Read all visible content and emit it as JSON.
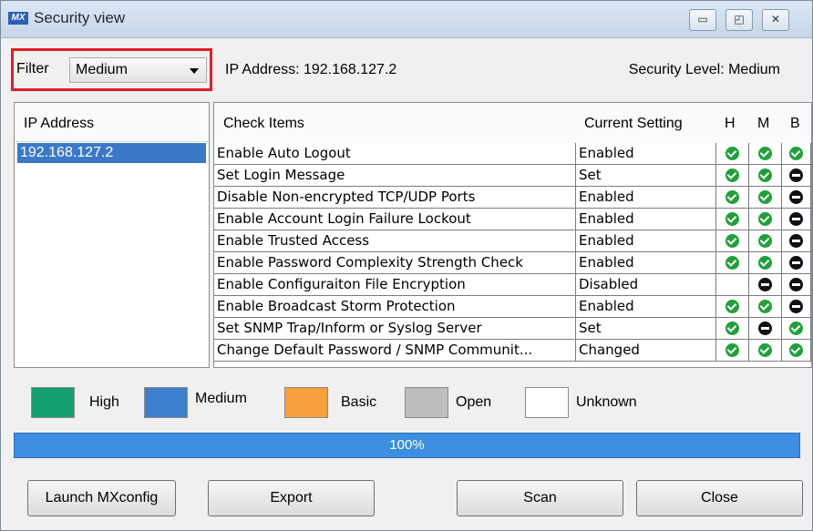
{
  "window": {
    "title": "Security view",
    "app_icon_text": "MX"
  },
  "filter": {
    "label": "Filter",
    "value": "Medium"
  },
  "header": {
    "ip_address_text": "IP Address:  192.168.127.2",
    "security_level_text": "Security Level:  Medium"
  },
  "left_panel": {
    "header": "IP Address",
    "items": [
      "192.168.127.2"
    ]
  },
  "table": {
    "columns": [
      "Check Items",
      "Current Setting",
      "H",
      "M",
      "B"
    ],
    "rows": [
      {
        "item": "Enable Auto Logout",
        "setting": "Enabled",
        "h": "check",
        "m": "check",
        "b": "check"
      },
      {
        "item": "Set Login Message",
        "setting": "Set",
        "h": "check",
        "m": "check",
        "b": "block"
      },
      {
        "item": "Disable Non-encrypted TCP/UDP Ports",
        "setting": "Enabled",
        "h": "check",
        "m": "check",
        "b": "block"
      },
      {
        "item": "Enable Account Login Failure Lockout",
        "setting": "Enabled",
        "h": "check",
        "m": "check",
        "b": "block"
      },
      {
        "item": "Enable Trusted Access",
        "setting": "Enabled",
        "h": "check",
        "m": "check",
        "b": "block"
      },
      {
        "item": "Enable Password Complexity Strength Check",
        "setting": "Enabled",
        "h": "check",
        "m": "check",
        "b": "block"
      },
      {
        "item": "Enable Configuraiton File Encryption",
        "setting": "Disabled",
        "h": "none",
        "m": "block",
        "b": "block"
      },
      {
        "item": "Enable Broadcast Storm Protection",
        "setting": "Enabled",
        "h": "check",
        "m": "check",
        "b": "block"
      },
      {
        "item": "Set SNMP Trap/Inform or Syslog Server",
        "setting": "Set",
        "h": "check",
        "m": "block",
        "b": "check"
      },
      {
        "item": "Change Default Password / SNMP Communit...",
        "setting": "Changed",
        "h": "check",
        "m": "check",
        "b": "check"
      }
    ]
  },
  "legend": [
    {
      "label": "High",
      "color": "#14a06f"
    },
    {
      "label": "Medium",
      "color": "#3c7fcc"
    },
    {
      "label": "Basic",
      "color": "#f7a03c"
    },
    {
      "label": "Open",
      "color": "#bdbdbd"
    },
    {
      "label": "Unknown",
      "color": "#ffffff"
    }
  ],
  "progress": {
    "value": 100,
    "label": "100%"
  },
  "buttons": {
    "launch": "Launch MXconfig",
    "export": "Export",
    "scan": "Scan",
    "close": "Close"
  },
  "colors": {
    "selected_row": "#3b79c8",
    "check": "#21a03a",
    "block": "#111111",
    "progress": "#3d8ee0",
    "filter_highlight": "#e01f26"
  }
}
